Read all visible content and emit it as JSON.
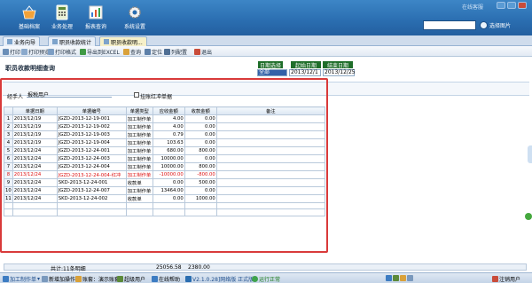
{
  "nav": [
    {
      "label": "基础档案",
      "icon": "basket-icon"
    },
    {
      "label": "业务处理",
      "icon": "calculator-icon"
    },
    {
      "label": "报表查询",
      "icon": "report-icon"
    },
    {
      "label": "系统设置",
      "icon": "gear-icon"
    }
  ],
  "banner_right": "在线客服",
  "search_button": "选择图片",
  "tabs": [
    {
      "label": "业务向导"
    },
    {
      "label": "职员收款统计"
    },
    {
      "label": "职员收款明..."
    }
  ],
  "toolbar": [
    {
      "label": "打印"
    },
    {
      "label": "打印预览"
    },
    {
      "label": "打印格式"
    },
    {
      "label": "导出到EXCEL"
    },
    {
      "label": "查询"
    },
    {
      "label": "定位"
    },
    {
      "label": "列配置"
    },
    {
      "label": "退出"
    }
  ],
  "page_title": "职员收款明细查询",
  "header_tags": {
    "date_option": "日期选择",
    "start_date": "起始日期",
    "end_date": "结束日期"
  },
  "header_values": {
    "date_option": "全部",
    "start_date": "2013/12/1",
    "end_date": "2013/12/25"
  },
  "filter": {
    "agent_label": "经手人",
    "agent_value": "报税用户",
    "checkbox_label": "挂账红冲单据"
  },
  "table": {
    "columns": [
      "单据日期",
      "单据编号",
      "单据类型",
      "应收金额",
      "收款金额",
      "备注"
    ],
    "rows": [
      {
        "idx": "1",
        "date": "2013/12/19",
        "no": "JGZD-2013-12-19-001",
        "type": "加工制作单",
        "due": "4.00",
        "paid": "0.00",
        "note": ""
      },
      {
        "idx": "2",
        "date": "2013/12/19",
        "no": "JGZD-2013-12-19-002",
        "type": "加工制作单",
        "due": "4.00",
        "paid": "0.00",
        "note": ""
      },
      {
        "idx": "3",
        "date": "2013/12/19",
        "no": "JGZD-2013-12-19-003",
        "type": "加工制作单",
        "due": "0.79",
        "paid": "0.00",
        "note": ""
      },
      {
        "idx": "4",
        "date": "2013/12/19",
        "no": "JGZD-2013-12-19-004",
        "type": "加工制作单",
        "due": "103.63",
        "paid": "0.00",
        "note": ""
      },
      {
        "idx": "5",
        "date": "2013/12/24",
        "no": "JGZD-2013-12-24-001",
        "type": "加工制作单",
        "due": "680.00",
        "paid": "800.00",
        "note": ""
      },
      {
        "idx": "6",
        "date": "2013/12/24",
        "no": "JGZD-2013-12-24-003",
        "type": "加工制作单",
        "due": "10000.00",
        "paid": "0.00",
        "note": ""
      },
      {
        "idx": "7",
        "date": "2013/12/24",
        "no": "JGZD-2013-12-24-004",
        "type": "加工制作单",
        "due": "10000.00",
        "paid": "800.00",
        "note": ""
      },
      {
        "idx": "8",
        "date": "2013/12/24",
        "no": "JGZD-2013-12-24-004-红冲",
        "type": "加工制作单",
        "due": "-10000.00",
        "paid": "-800.00",
        "note": "",
        "red": true
      },
      {
        "idx": "9",
        "date": "2013/12/24",
        "no": "SKD-2013-12-24-001",
        "type": "收款单",
        "due": "0.00",
        "paid": "500.00",
        "note": ""
      },
      {
        "idx": "10",
        "date": "2013/12/24",
        "no": "JGZD-2013-12-24-007",
        "type": "加工制作单",
        "due": "13464.00",
        "paid": "0.00",
        "note": ""
      },
      {
        "idx": "11",
        "date": "2013/12/24",
        "no": "SKD-2013-12-24-002",
        "type": "收款单",
        "due": "0.00",
        "paid": "1000.00",
        "note": ""
      }
    ]
  },
  "summary": {
    "label": "共计:11条明细",
    "due_total": "25056.58",
    "paid_total": "2380.00"
  },
  "statusbar": [
    {
      "label": "加工制作单",
      "color": "#1f4e8c"
    },
    {
      "label": "新增加操作"
    },
    {
      "label": "账套：演示账套"
    },
    {
      "label": "超级用户"
    },
    {
      "label": "在线帮助"
    },
    {
      "label": "V2.1.0.28]网络版 正式版"
    },
    {
      "label": "运行正常"
    },
    {
      "label": "注销用户"
    }
  ]
}
